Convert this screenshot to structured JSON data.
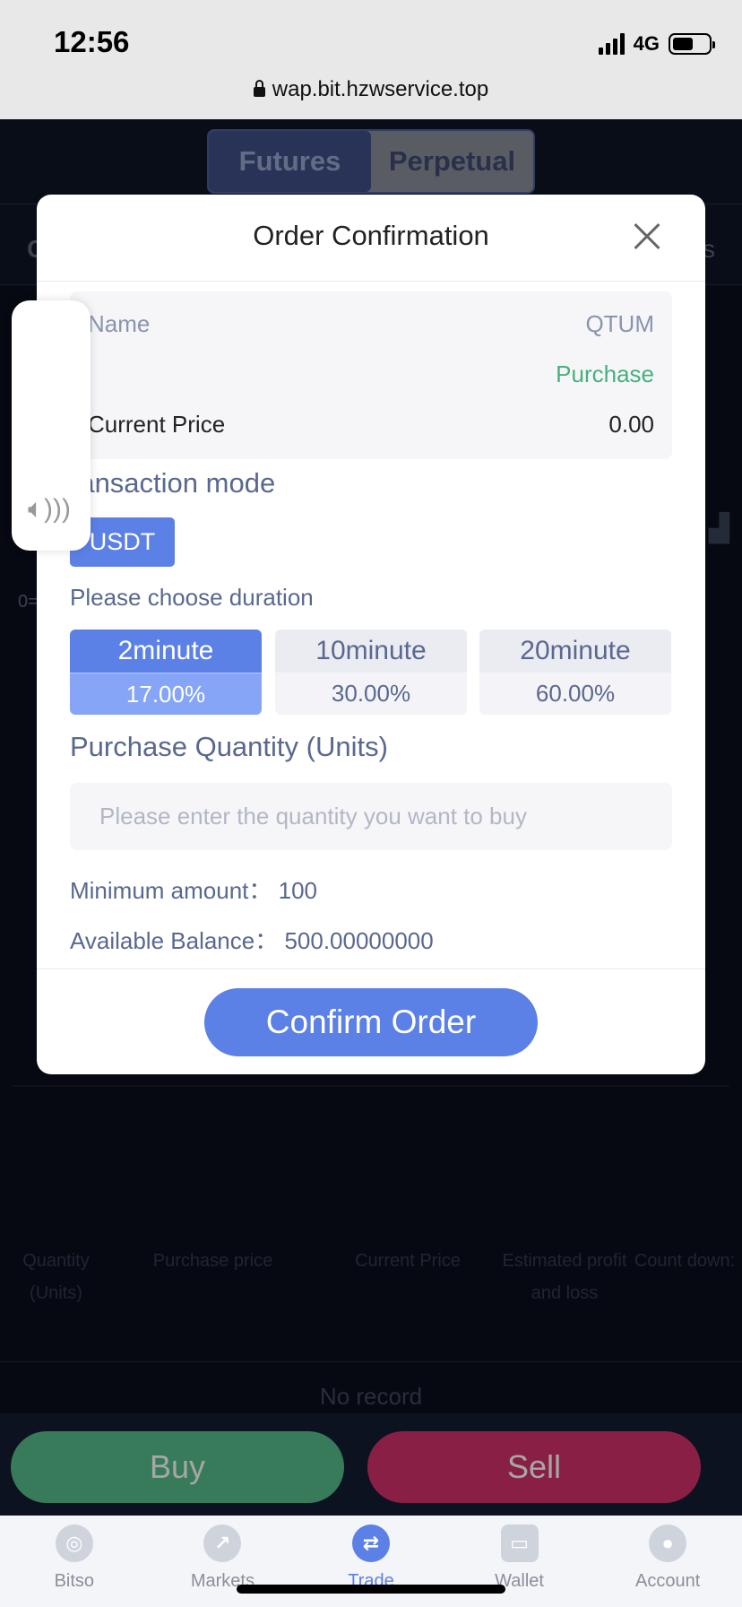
{
  "status_bar": {
    "time": "12:56",
    "network": "4G",
    "url": "wap.bit.hzwservice.top"
  },
  "background": {
    "segment": {
      "active": "Futures",
      "inactive": "Perpetual"
    },
    "tab_left_partial": "C",
    "tab_right_partial": "s",
    "partial_label": "0=",
    "table_headers": [
      "Quantity (Units)",
      "Purchase price",
      "Current Price",
      "Estimated profit and loss",
      "Count down:"
    ],
    "empty_text": "No record",
    "buy_label": "Buy",
    "sell_label": "Sell"
  },
  "tabbar": {
    "items": [
      {
        "label": "Bitso",
        "icon": "bitso-logo-icon"
      },
      {
        "label": "Markets",
        "icon": "markets-trend-icon"
      },
      {
        "label": "Trade",
        "icon": "trade-exchange-icon",
        "active": true
      },
      {
        "label": "Wallet",
        "icon": "wallet-icon"
      },
      {
        "label": "Account",
        "icon": "user-icon"
      }
    ]
  },
  "modal": {
    "title": "Order Confirmation",
    "info": {
      "name_label": "Name",
      "name_value": "QTUM",
      "direction_value": "Purchase",
      "price_label": "Current Price",
      "price_value": "0.00"
    },
    "mode_title": "ransaction mode",
    "mode_option": "USDT",
    "duration_title": "Please choose duration",
    "durations": [
      {
        "label": "2minute",
        "rate": "17.00%",
        "selected": true
      },
      {
        "label": "10minute",
        "rate": "30.00%",
        "selected": false
      },
      {
        "label": "20minute",
        "rate": "60.00%",
        "selected": false
      }
    ],
    "quantity_title": "Purchase Quantity (Units)",
    "quantity_placeholder": "Please enter the quantity you want to buy",
    "min_amount": "Minimum amount： 100",
    "available_balance": "Available Balance： 500.00000000",
    "confirm_label": "Confirm Order"
  },
  "colors": {
    "accent": "#5b80e6",
    "buy": "#55bd8a",
    "sell": "#d33169",
    "purchase_text": "#45b17d"
  }
}
